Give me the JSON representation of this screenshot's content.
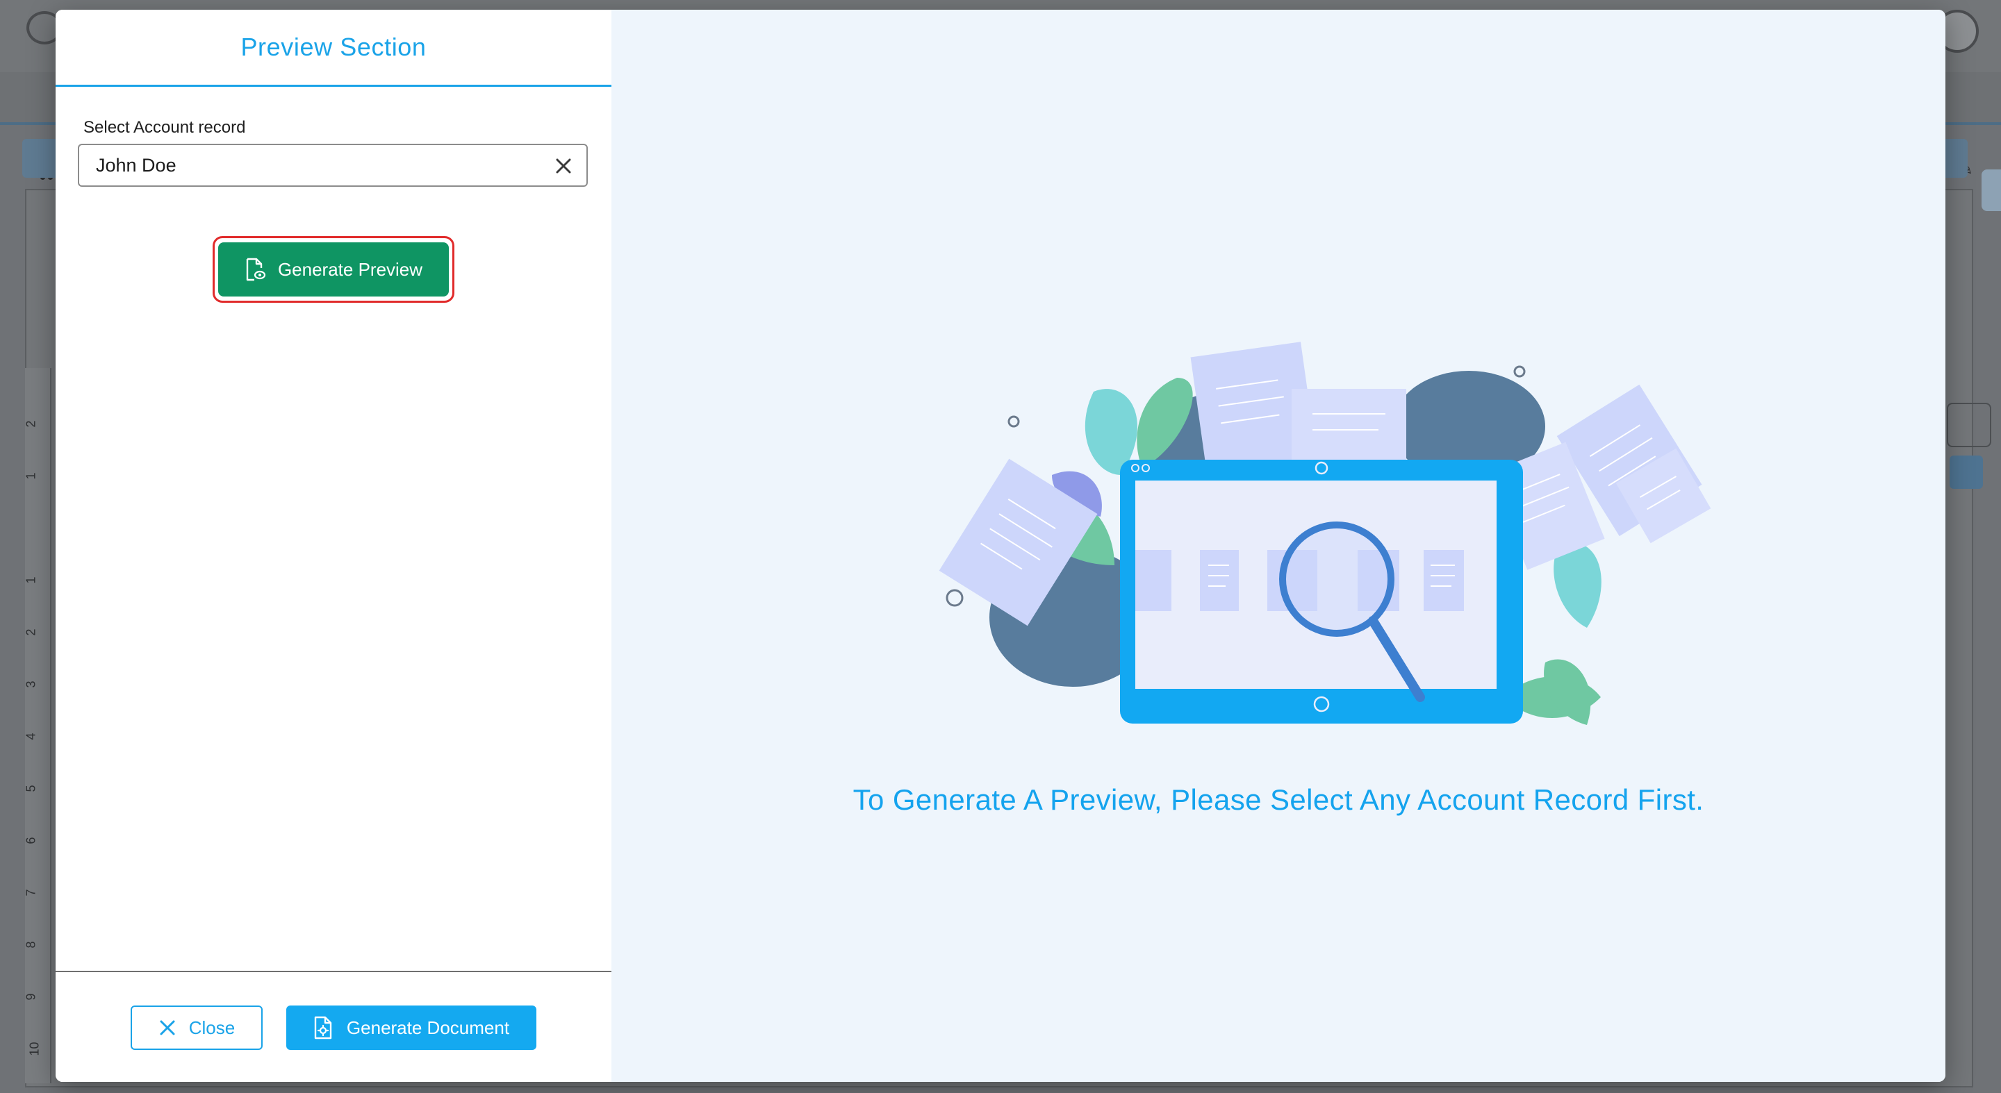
{
  "modal": {
    "left_panel": {
      "title": "Preview Section",
      "account_field": {
        "label": "Select Account record",
        "value": "John Doe"
      },
      "generate_preview_label": "Generate Preview"
    },
    "footer": {
      "close_label": "Close",
      "generate_document_label": "Generate Document"
    },
    "right_panel": {
      "message": "To Generate A Preview, Please Select Any Account Record First."
    }
  },
  "background": {
    "ruler_numbers": [
      "2",
      "1",
      "1",
      "2",
      "3",
      "4",
      "5",
      "6",
      "7",
      "8",
      "9",
      "10"
    ]
  },
  "colors": {
    "accent": "#1aa3e8",
    "preview_button": "#0f9563",
    "highlight_ring": "#e12b2b",
    "message_text": "#14a3ee"
  },
  "icons": {
    "clear": "close-x-icon",
    "generate_preview": "document-preview-icon",
    "close": "close-x-icon",
    "generate_document": "document-settings-icon"
  }
}
